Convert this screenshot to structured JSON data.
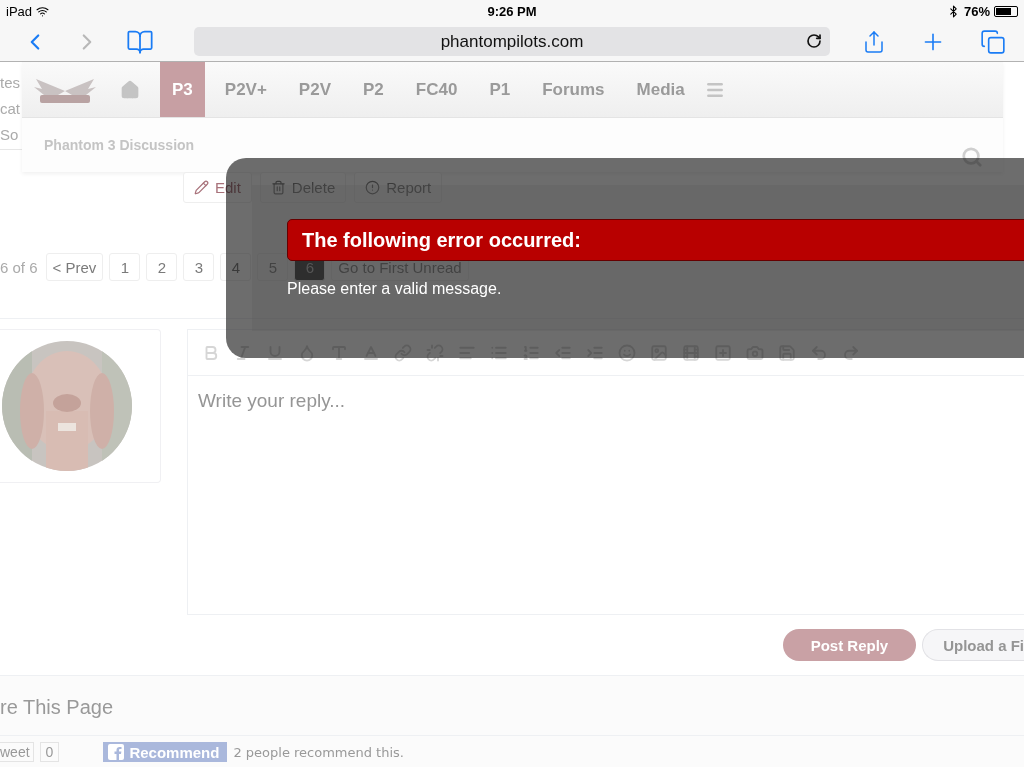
{
  "status_bar": {
    "device": "iPad",
    "time": "9:26 PM",
    "battery": "76%"
  },
  "browser": {
    "url": "phantompilots.com"
  },
  "page_edge_text": [
    "tes",
    "cat",
    "So"
  ],
  "nav": {
    "tabs": [
      {
        "label": "P3",
        "selected": true
      },
      {
        "label": "P2V+",
        "selected": false
      },
      {
        "label": "P2V",
        "selected": false
      },
      {
        "label": "P2",
        "selected": false
      },
      {
        "label": "FC40",
        "selected": false
      },
      {
        "label": "P1",
        "selected": false
      },
      {
        "label": "Forums",
        "selected": false
      },
      {
        "label": "Media",
        "selected": false
      }
    ]
  },
  "subheader": {
    "title": "Phantom 3 Discussion"
  },
  "post_actions": [
    {
      "label": "Edit",
      "kind": "edit"
    },
    {
      "label": "Delete",
      "kind": "delete"
    },
    {
      "label": "Report",
      "kind": "report"
    }
  ],
  "pagination": {
    "summary": "6 of 6",
    "prev": "< Prev",
    "pages": [
      {
        "label": "1",
        "selected": false
      },
      {
        "label": "2",
        "selected": false
      },
      {
        "label": "3",
        "selected": false
      },
      {
        "label": "4",
        "selected": false
      },
      {
        "label": "5",
        "selected": false
      },
      {
        "label": "6",
        "selected": true
      }
    ],
    "first_unread": "Go to First Unread"
  },
  "editor": {
    "placeholder": "Write your reply..."
  },
  "buttons": [
    {
      "label": "Post Reply",
      "kind": "primary"
    },
    {
      "label": "Upload a Fi",
      "kind": "secondary"
    }
  ],
  "share": {
    "title": "re This Page",
    "tweet": "weet",
    "tweet_count": "0",
    "recommend": "Recommend",
    "recommend_text": "2 people recommend this."
  },
  "dialog": {
    "title": "The following error occurred:",
    "message": "Please enter a valid message."
  }
}
